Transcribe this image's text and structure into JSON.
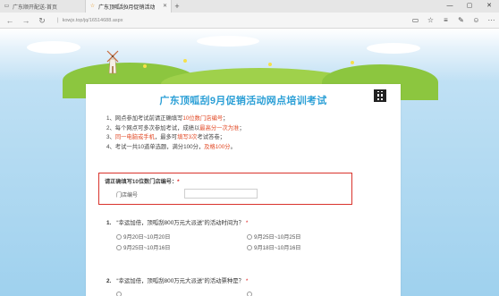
{
  "browser": {
    "tabs": [
      {
        "title": "广东顺开配送-首页",
        "active": false
      },
      {
        "title": "广东顶呱刮9月促销活动",
        "active": true
      }
    ],
    "new_tab": "+",
    "url": "kowjx.top/jq/16514688.aspx",
    "window_controls": [
      "—",
      "▢",
      "✕"
    ],
    "nav": {
      "back": "←",
      "forward": "→",
      "refresh": "↻"
    },
    "tools": [
      "▭",
      "☆",
      "≡",
      "✎",
      "☺",
      "···"
    ]
  },
  "survey": {
    "title": "广东顶呱刮9月促销活动网点培训考试",
    "rules": [
      {
        "prefix": "1、网点参加考试前请正确填写",
        "highlight": "10位数门店编号",
        "suffix": "；"
      },
      {
        "prefix": "2、每个网点可多次参加考试，成绩以",
        "highlight": "最高分一次为准",
        "suffix": "；"
      },
      {
        "prefix": "3、",
        "highlight": "同一电脑或手机",
        "suffix": "，最多可",
        "highlight2": "填写3次",
        "suffix2": "考试答卷；"
      },
      {
        "prefix": "4、考试一共10道单选题，满分100分，",
        "highlight": "及格100分",
        "suffix": "。"
      }
    ],
    "store_code": {
      "label": "请正确填写10位数门店编号：",
      "required": "*",
      "field_label": "门店编号",
      "value": "",
      "placeholder": ""
    },
    "questions": [
      {
        "num": "1.",
        "text": "“幸运加倍，顶呱刮800万元大派送”的活动时间为？",
        "required": "*",
        "options": [
          "9月20日~10月20日",
          "9月25日~10月25日",
          "9月25日~10月16日",
          "9月18日~10月16日"
        ]
      },
      {
        "num": "2.",
        "text": "“幸运加倍，顶呱刮800万元大派送”的活动票种是？",
        "required": "*"
      }
    ]
  },
  "colors": {
    "title_blue": "#2b9fd6",
    "highlight_red": "#e24a26",
    "box_red": "#d9332c"
  }
}
